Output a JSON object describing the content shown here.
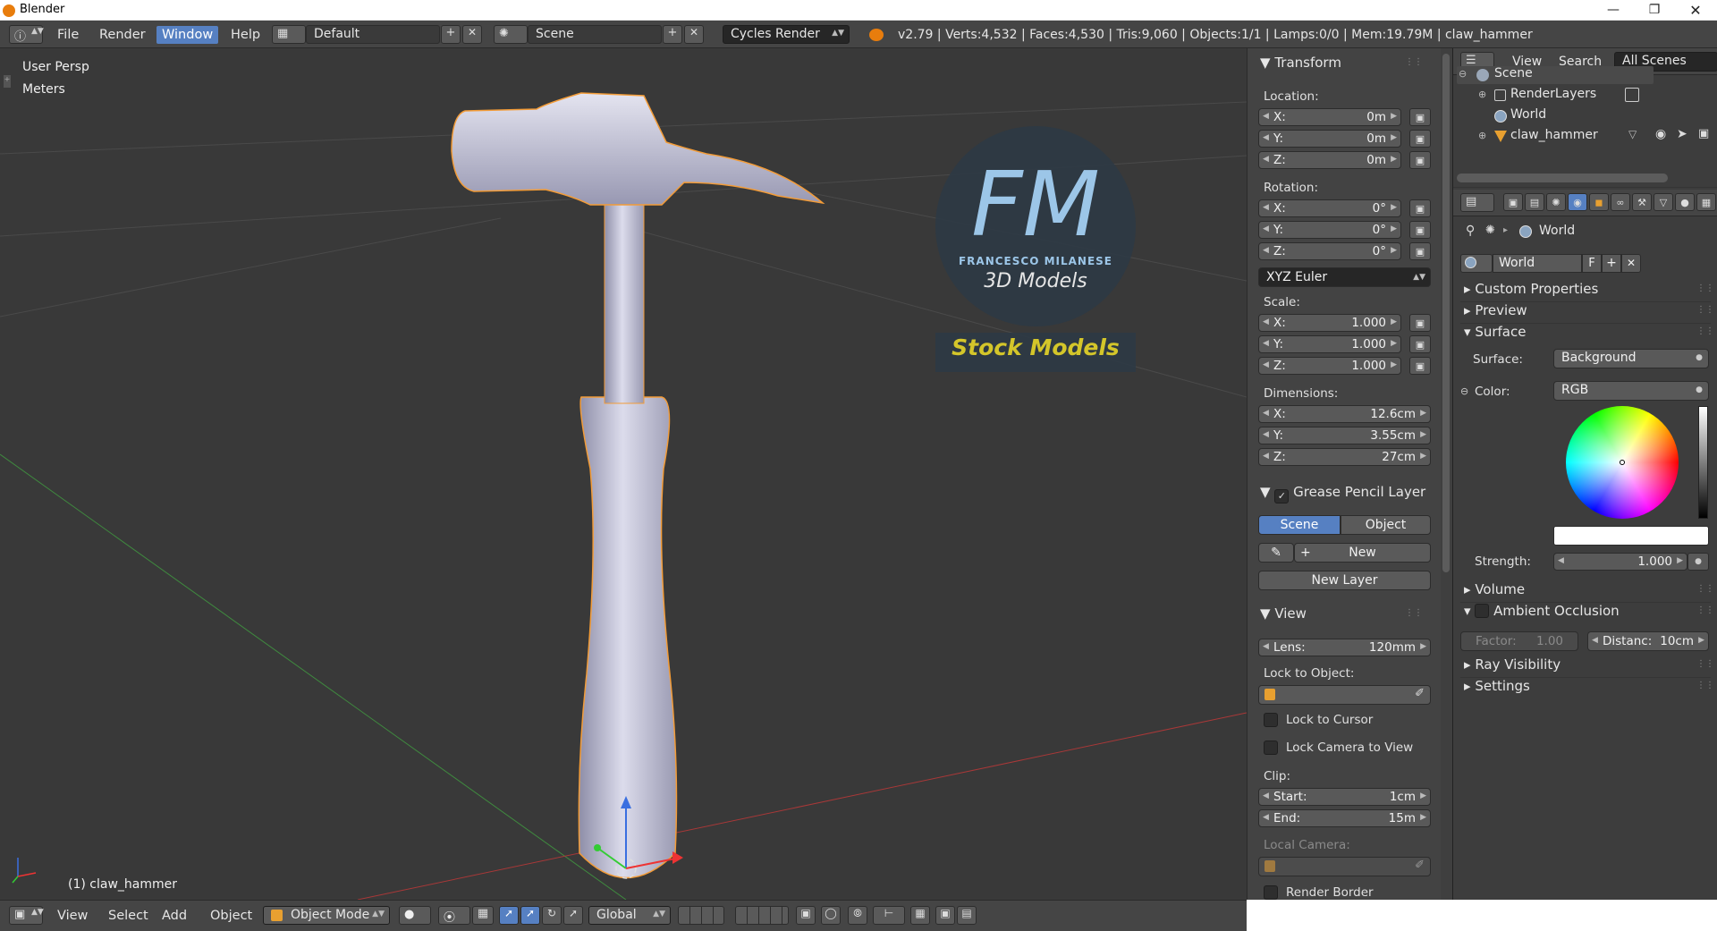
{
  "window": {
    "title": "Blender"
  },
  "info_header": {
    "menus": [
      "File",
      "Render",
      "Window",
      "Help"
    ],
    "active_menu": "Window",
    "screen_layout": "Default",
    "scene": "Scene",
    "render_engine": "Cycles Render",
    "stats": "v2.79 | Verts:4,532 | Faces:4,530 | Tris:9,060 | Objects:1/1 | Lamps:0/0 | Mem:19.79M | claw_hammer"
  },
  "viewport": {
    "view_label": "User Persp",
    "units_label": "Meters",
    "object_label": "(1) claw_hammer",
    "watermark": {
      "letters": "FM",
      "brand": "FRANCESCO MILANESE",
      "tagline": "3D Models",
      "banner": "Stock Models"
    }
  },
  "transform": {
    "title": "Transform",
    "location_label": "Location:",
    "location": [
      {
        "axis": "X:",
        "value": "0m"
      },
      {
        "axis": "Y:",
        "value": "0m"
      },
      {
        "axis": "Z:",
        "value": "0m"
      }
    ],
    "rotation_label": "Rotation:",
    "rotation": [
      {
        "axis": "X:",
        "value": "0°"
      },
      {
        "axis": "Y:",
        "value": "0°"
      },
      {
        "axis": "Z:",
        "value": "0°"
      }
    ],
    "rotation_mode": "XYZ Euler",
    "scale_label": "Scale:",
    "scale": [
      {
        "axis": "X:",
        "value": "1.000"
      },
      {
        "axis": "Y:",
        "value": "1.000"
      },
      {
        "axis": "Z:",
        "value": "1.000"
      }
    ],
    "dimensions_label": "Dimensions:",
    "dimensions": [
      {
        "axis": "X:",
        "value": "12.6cm"
      },
      {
        "axis": "Y:",
        "value": "3.55cm"
      },
      {
        "axis": "Z:",
        "value": "27cm"
      }
    ]
  },
  "grease_pencil": {
    "title": "Grease Pencil Layer",
    "scene_tab": "Scene",
    "object_tab": "Object",
    "new_label": "New",
    "new_layer_label": "New Layer"
  },
  "view_panel": {
    "title": "View",
    "lens_label": "Lens:",
    "lens_value": "120mm",
    "lock_to_object_label": "Lock to Object:",
    "lock_to_cursor_label": "Lock to Cursor",
    "lock_camera_label": "Lock Camera to View",
    "clip_label": "Clip:",
    "clip_start_label": "Start:",
    "clip_start_value": "1cm",
    "clip_end_label": "End:",
    "clip_end_value": "15m",
    "local_camera_label": "Local Camera:",
    "render_border_label": "Render Border"
  },
  "outliner": {
    "menu_view": "View",
    "menu_search": "Search",
    "filter": "All Scenes",
    "items": [
      {
        "label": "Scene"
      },
      {
        "label": "RenderLayers"
      },
      {
        "label": "World"
      },
      {
        "label": "claw_hammer"
      }
    ]
  },
  "properties": {
    "breadcrumb": "World",
    "world_name": "World",
    "fake_user": "F",
    "sections": {
      "custom_properties": "Custom Properties",
      "preview": "Preview",
      "surface": "Surface",
      "volume": "Volume",
      "ambient_occlusion": "Ambient Occlusion",
      "ray_visibility": "Ray Visibility",
      "settings": "Settings"
    },
    "surface_label": "Surface:",
    "surface_value": "Background",
    "color_label": "Color:",
    "color_mode": "RGB",
    "color_value": "#ffffff",
    "strength_label": "Strength:",
    "strength_value": "1.000",
    "ao_factor_label": "Factor:",
    "ao_factor_value": "1.00",
    "ao_distance_label": "Distanc:",
    "ao_distance_value": "10cm"
  },
  "bottom_header": {
    "menus": [
      "View",
      "Select",
      "Add",
      "Object"
    ],
    "mode": "Object Mode",
    "orientation": "Global"
  },
  "colors": {
    "accent": "#5680c2",
    "selection_outline": "#f39c38",
    "watermark_text": "#9cc6e8",
    "banner_text": "#d4c62a",
    "panel_bg": "#3f3f3f",
    "viewport_bg": "#393939"
  }
}
